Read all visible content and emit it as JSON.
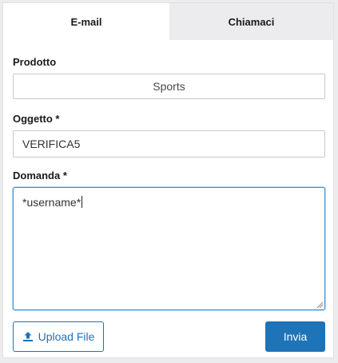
{
  "tabs": [
    {
      "label": "E-mail",
      "active": true
    },
    {
      "label": "Chiamaci",
      "active": false
    }
  ],
  "form": {
    "product": {
      "label": "Prodotto",
      "value": "Sports"
    },
    "subject": {
      "label": "Oggetto *",
      "value": "VERIFICA5"
    },
    "question": {
      "label": "Domanda *",
      "value": "*username*"
    }
  },
  "buttons": {
    "upload_label": "Upload File",
    "upload_icon": "upload-icon",
    "send_label": "Invia"
  },
  "colors": {
    "accent": "#1f73b7",
    "focus_border": "#3d8fd6",
    "inactive_tab": "#ececef"
  }
}
